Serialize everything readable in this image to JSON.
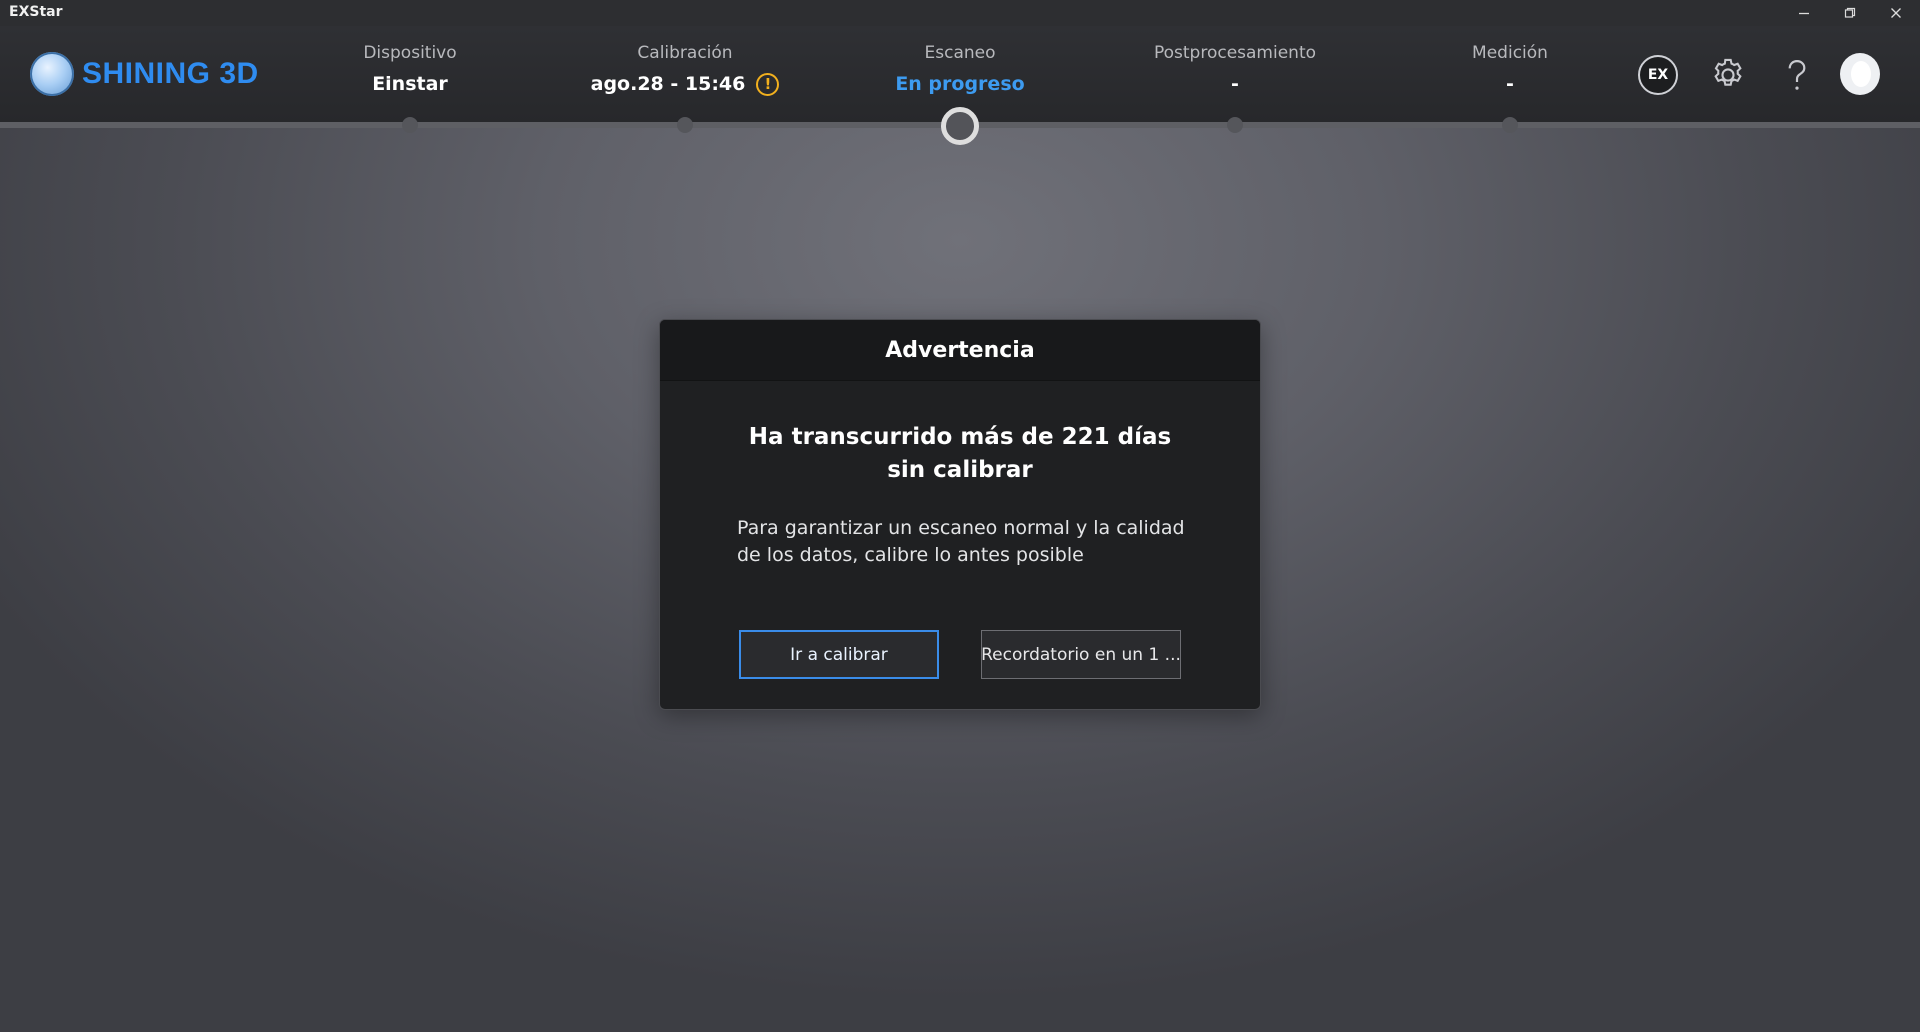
{
  "window": {
    "title": "EXStar",
    "minimize_glyph": "–",
    "restore_glyph": "❐",
    "close_glyph": "✕"
  },
  "header": {
    "logo_text": "SHINING 3D",
    "steps": [
      {
        "label": "Dispositivo",
        "value": "Einstar"
      },
      {
        "label": "Calibración",
        "value": "ago.28 - 15:46",
        "warning": "!"
      },
      {
        "label": "Escaneo",
        "value": "En progreso",
        "active": true
      },
      {
        "label": "Postprocesamiento",
        "value": "-"
      },
      {
        "label": "Medición",
        "value": "-"
      }
    ],
    "icons": {
      "ex_model": "EX",
      "settings": "gear-icon",
      "help": "help-icon",
      "account": "avatar-icon"
    }
  },
  "dialog": {
    "title": "Advertencia",
    "heading": "Ha transcurrido más de 221 días sin calibrar",
    "message": "Para garantizar un escaneo normal y la calidad de los datos, calibre lo antes posible",
    "primary_button": "Ir a calibrar",
    "secondary_button": "Recordatorio en un 1 ..."
  },
  "colors": {
    "accent": "#3d9bf0",
    "logo": "#2f8cf0",
    "warning": "#f2b01e"
  }
}
